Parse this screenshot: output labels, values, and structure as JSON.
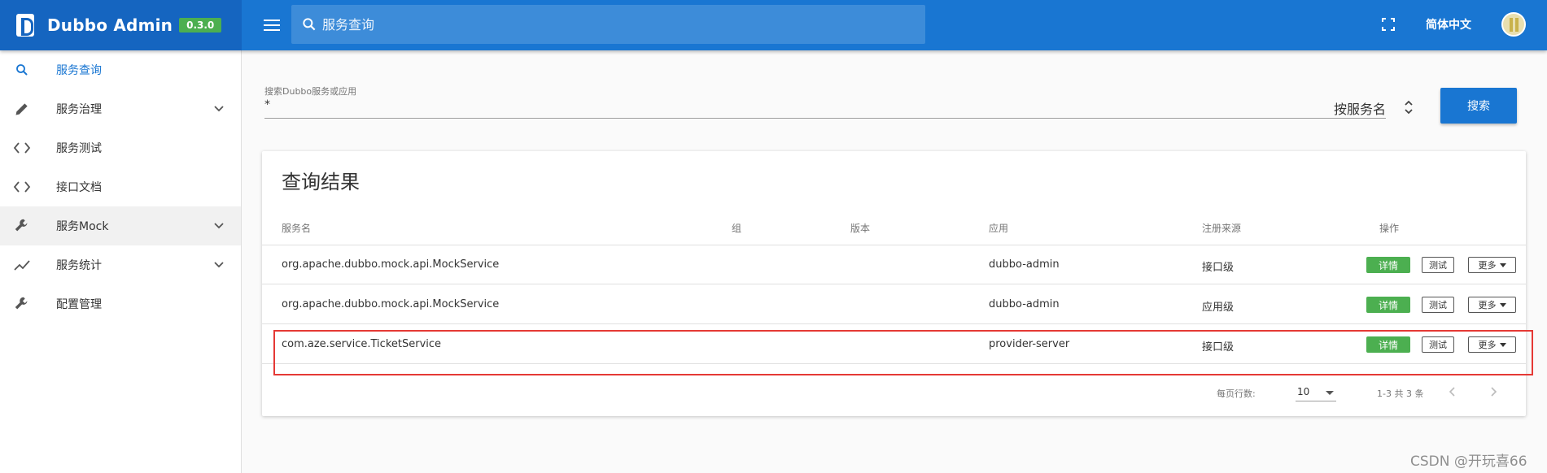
{
  "header": {
    "app_title": "Dubbo Admin",
    "version": "0.3.0",
    "search_placeholder": "服务查询",
    "language": "简体中文"
  },
  "sidebar": {
    "items": [
      {
        "label": "服务查询",
        "icon": "search-icon",
        "selected": true
      },
      {
        "label": "服务治理",
        "icon": "pencil-icon",
        "expandable": true
      },
      {
        "label": "服务测试",
        "icon": "code-icon"
      },
      {
        "label": "接口文档",
        "icon": "code-icon"
      },
      {
        "label": "服务Mock",
        "icon": "wrench-icon",
        "expandable": true,
        "highlighted": true
      },
      {
        "label": "服务统计",
        "icon": "trending-icon",
        "expandable": true
      },
      {
        "label": "配置管理",
        "icon": "wrench-icon"
      }
    ]
  },
  "search_form": {
    "label": "搜索Dubbo服务或应用",
    "value": "*",
    "mode": "按服务名",
    "button": "搜索"
  },
  "results": {
    "title": "查询结果",
    "columns": [
      "服务名",
      "组",
      "版本",
      "应用",
      "注册来源",
      "操作"
    ],
    "rows": [
      {
        "service": "org.apache.dubbo.mock.api.MockService",
        "group": "",
        "version": "",
        "app": "dubbo-admin",
        "source": "接口级"
      },
      {
        "service": "org.apache.dubbo.mock.api.MockService",
        "group": "",
        "version": "",
        "app": "dubbo-admin",
        "source": "应用级"
      },
      {
        "service": "com.aze.service.TicketService",
        "group": "",
        "version": "",
        "app": "provider-server",
        "source": "接口级"
      }
    ],
    "actions": {
      "detail": "详情",
      "test": "测试",
      "more": "更多"
    },
    "footer": {
      "rows_per_page_label": "每页行数:",
      "rows_per_page": "10",
      "range": "1-3 共 3 条"
    }
  },
  "watermark": "CSDN @开玩喜66",
  "colors": {
    "primary": "#1976d2",
    "brand_bg": "#1565c0",
    "success": "#4caf50",
    "highlight_border": "#e53935"
  }
}
